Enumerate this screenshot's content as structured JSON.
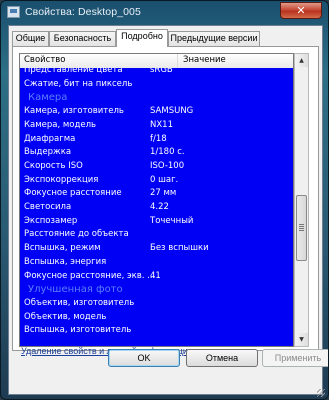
{
  "window": {
    "title": "Свойства: Desktop_005",
    "close_glyph": "✕"
  },
  "tabs": [
    {
      "label": "Общие"
    },
    {
      "label": "Безопасность"
    },
    {
      "label": "Подробно"
    },
    {
      "label": "Предыдущие версии"
    }
  ],
  "list": {
    "col_name": "Свойство",
    "col_value": "Значение",
    "rows": [
      {
        "name": "Представление цвета",
        "value": "sRGB"
      },
      {
        "name": "Сжатие, бит на пиксель",
        "value": ""
      },
      {
        "name": "Камера",
        "value": "",
        "group": true
      },
      {
        "name": "Камера, изготовитель",
        "value": "SAMSUNG"
      },
      {
        "name": "Камера, модель",
        "value": "NX11"
      },
      {
        "name": "Диафрагма",
        "value": "f/18"
      },
      {
        "name": "Выдержка",
        "value": "1/180 с."
      },
      {
        "name": "Скорость ISO",
        "value": "ISO-100"
      },
      {
        "name": "Экспокоррекция",
        "value": "0 шаг."
      },
      {
        "name": "Фокусное расстояние",
        "value": "27 мм"
      },
      {
        "name": "Светосила",
        "value": "4.22"
      },
      {
        "name": "Экспозамер",
        "value": "Точечный"
      },
      {
        "name": "Расстояние до объекта",
        "value": ""
      },
      {
        "name": "Вспышка, режим",
        "value": "Без вспышки"
      },
      {
        "name": "Вспышка, энергия",
        "value": ""
      },
      {
        "name": "Фокусное расстояние, экв. ...",
        "value": "41"
      },
      {
        "name": "Улучшенная фото",
        "value": "",
        "group": true
      },
      {
        "name": "Объектив, изготовитель",
        "value": ""
      },
      {
        "name": "Объектив, модель",
        "value": ""
      },
      {
        "name": "Вспышка, изготовитель",
        "value": ""
      }
    ]
  },
  "link_text": "Удаление свойств и личной информации",
  "buttons": {
    "ok": "OK",
    "cancel": "Отмена",
    "apply": "Применить"
  },
  "colors": {
    "selection_bg": "#0000f5",
    "group_text": "#5a7ffb"
  }
}
